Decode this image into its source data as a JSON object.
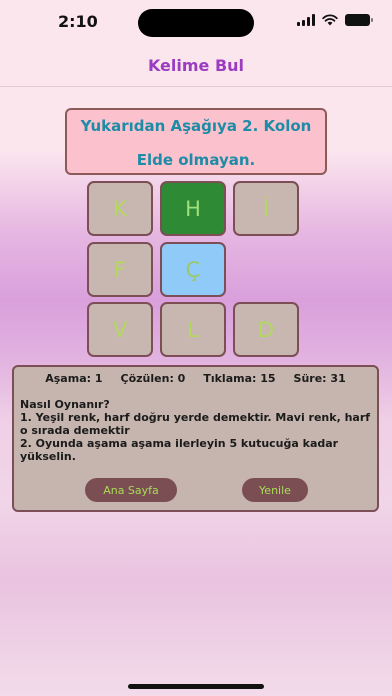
{
  "status_bar": {
    "time": "2:10"
  },
  "nav": {
    "title": "Kelime Bul"
  },
  "question": {
    "line1": "Yukarıdan Aşağıya 2. Kolon",
    "line2": "Elde olmayan."
  },
  "grid": {
    "rows": [
      [
        {
          "letter": "K",
          "state": "normal"
        },
        {
          "letter": "H",
          "state": "correct"
        },
        {
          "letter": "İ",
          "state": "normal"
        }
      ],
      [
        {
          "letter": "F",
          "state": "normal"
        },
        {
          "letter": "Ç",
          "state": "present"
        }
      ],
      [
        {
          "letter": "V",
          "state": "normal"
        },
        {
          "letter": "L",
          "state": "normal"
        },
        {
          "letter": "D",
          "state": "normal"
        }
      ]
    ]
  },
  "stats": {
    "stage": "Aşama: 1",
    "solved": "Çözülen: 0",
    "clicks": "Tıklama: 15",
    "time": "Süre: 31"
  },
  "instructions": {
    "title": "Nasıl Oynanır?",
    "rule1": "1. Yeşil renk, harf doğru yerde demektir. Mavi renk, harf o sırada demektir",
    "rule2": " 2. Oyunda aşama aşama ilerleyin 5 kutucuğa kadar yükselin."
  },
  "buttons": {
    "home": "Ana Sayfa",
    "restart": "Yenile"
  },
  "colors": {
    "title": "#9c3cc0",
    "question_bg": "#fbc1cd",
    "question_text": "#1d8ca6",
    "tile_bg": "#c7b7b0",
    "tile_correct": "#2f8a35",
    "tile_present": "#8fcaf8",
    "letter": "#b3d85e",
    "button_bg": "#7a4e53"
  }
}
